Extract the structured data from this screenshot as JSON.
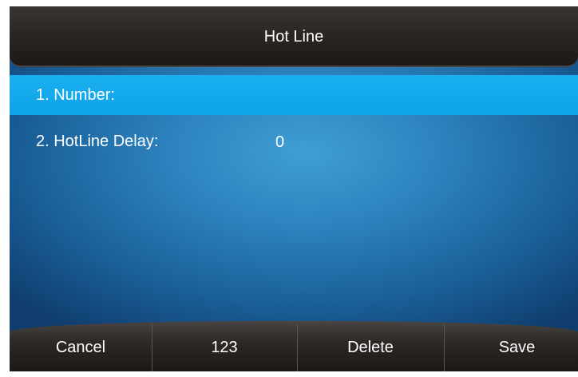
{
  "screen": {
    "title": "Hot Line"
  },
  "menu": {
    "items": [
      {
        "label": "1. Number:",
        "value": ""
      },
      {
        "label": "2. HotLine Delay:",
        "value": "0"
      }
    ]
  },
  "softkeys": [
    {
      "label": "Cancel"
    },
    {
      "label": "123"
    },
    {
      "label": "Delete"
    },
    {
      "label": "Save"
    }
  ],
  "colors": {
    "selection": "#0ea3e8",
    "background": "#2c82bd",
    "bars": "#2c2725",
    "text": "#ffffff"
  }
}
